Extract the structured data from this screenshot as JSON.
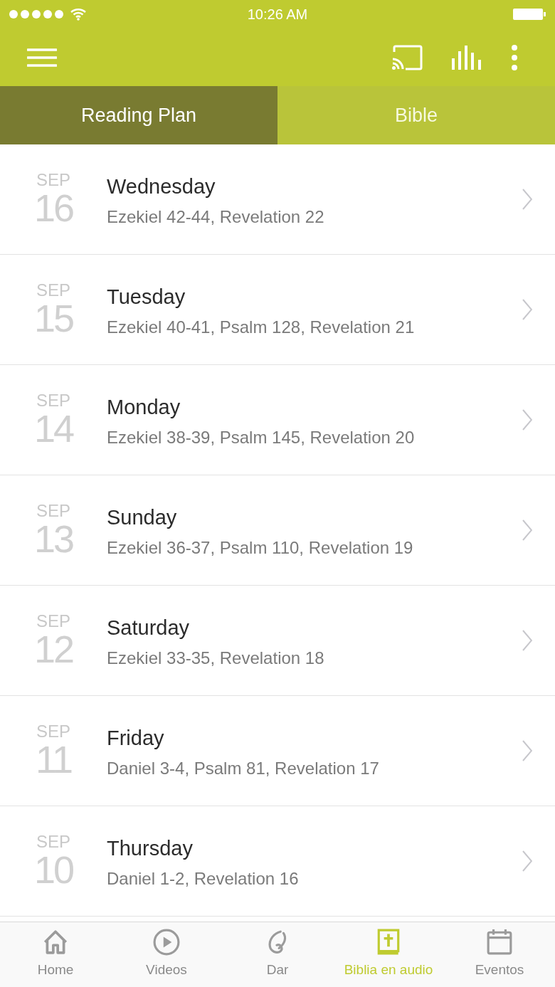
{
  "status_bar": {
    "time": "10:26 AM"
  },
  "tabs": [
    {
      "label": "Reading Plan",
      "selected": true
    },
    {
      "label": "Bible",
      "selected": false
    }
  ],
  "readings": [
    {
      "month": "SEP",
      "day": "16",
      "weekday": "Wednesday",
      "passages": "Ezekiel 42-44, Revelation 22"
    },
    {
      "month": "SEP",
      "day": "15",
      "weekday": "Tuesday",
      "passages": "Ezekiel 40-41, Psalm 128, Revelation 21"
    },
    {
      "month": "SEP",
      "day": "14",
      "weekday": "Monday",
      "passages": "Ezekiel 38-39, Psalm 145, Revelation 20"
    },
    {
      "month": "SEP",
      "day": "13",
      "weekday": "Sunday",
      "passages": "Ezekiel 36-37, Psalm 110, Revelation 19"
    },
    {
      "month": "SEP",
      "day": "12",
      "weekday": "Saturday",
      "passages": "Ezekiel 33-35, Revelation 18"
    },
    {
      "month": "SEP",
      "day": "11",
      "weekday": "Friday",
      "passages": "Daniel 3-4, Psalm 81, Revelation 17"
    },
    {
      "month": "SEP",
      "day": "10",
      "weekday": "Thursday",
      "passages": "Daniel 1-2, Revelation 16"
    }
  ],
  "bottom_nav": [
    {
      "kind": "home",
      "label": "Home",
      "selected": false
    },
    {
      "kind": "videos",
      "label": "Videos",
      "selected": false
    },
    {
      "kind": "give",
      "label": "Dar",
      "selected": false
    },
    {
      "kind": "bible",
      "label": "Biblia en audio",
      "selected": true
    },
    {
      "kind": "events",
      "label": "Eventos",
      "selected": false
    }
  ]
}
